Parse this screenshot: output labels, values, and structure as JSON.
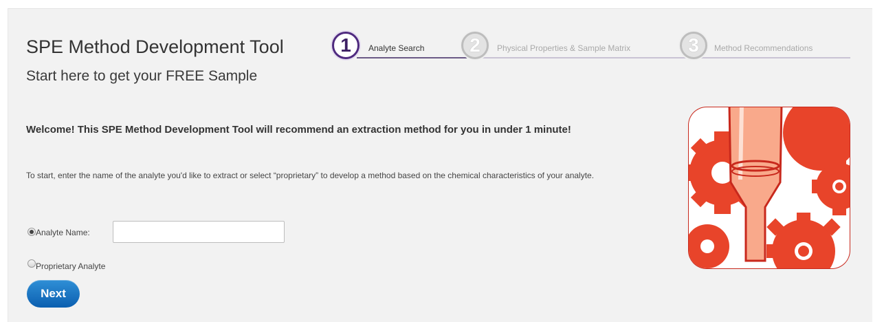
{
  "header": {
    "title": "SPE Method Development Tool",
    "subtitle": "Start here to get your FREE Sample"
  },
  "steps": [
    {
      "number": "1",
      "label": "Analyte Search",
      "state": "active"
    },
    {
      "number": "2",
      "label": "Physical Properties & Sample Matrix",
      "state": "inactive"
    },
    {
      "number": "3",
      "label": "Method Recommendations",
      "state": "inactive"
    }
  ],
  "intro": {
    "welcome": "Welcome! This SPE Method Development Tool will recommend an extraction method for you in under 1 minute!",
    "instructions": "To start, enter the name of the analyte you'd like to extract or select “proprietary” to develop a method based on the chemical characteristics of your analyte."
  },
  "form": {
    "analyte_name_label": "Analyte Name:",
    "analyte_name_value": "",
    "analyte_name_placeholder": "",
    "proprietary_label": "Proprietary Analyte",
    "selected_option": "analyte-name",
    "next_label": "Next"
  },
  "illustration": {
    "icon": "spe-cartridge-gears-icon",
    "colors": {
      "primary": "#e8442a",
      "accent": "#f9a98b",
      "border": "#c8281c"
    }
  },
  "colors": {
    "step_active": "#4f2a7f",
    "step_inactive": "#bdbdbd",
    "button": "#0b6fc4",
    "panel_background": "#f2f2f2"
  }
}
